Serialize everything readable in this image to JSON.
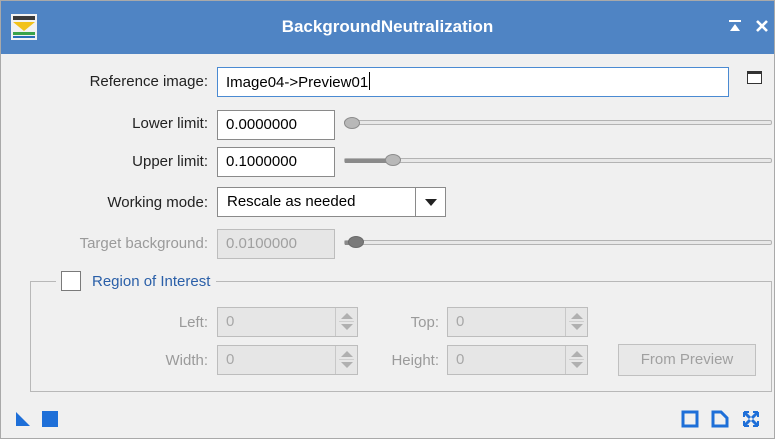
{
  "window": {
    "title": "BackgroundNeutralization",
    "colors": {
      "titlebar": "#4f84c4",
      "accent_icon": "#1e6fd8",
      "group_title": "#2a5fa8"
    }
  },
  "form": {
    "reference_image": {
      "label": "Reference image:",
      "value": "Image04->Preview01"
    },
    "lower_limit": {
      "label": "Lower limit:",
      "value": "0.0000000",
      "slider_fraction": 0.0
    },
    "upper_limit": {
      "label": "Upper limit:",
      "value": "0.1000000",
      "slider_fraction": 0.1
    },
    "working_mode": {
      "label": "Working mode:",
      "value": "Rescale as needed"
    },
    "target_background": {
      "label": "Target background:",
      "value": "0.0100000",
      "slider_fraction": 0.01,
      "enabled": false
    }
  },
  "roi": {
    "title": "Region of Interest",
    "checked": false,
    "left": {
      "label": "Left:",
      "value": "0"
    },
    "top": {
      "label": "Top:",
      "value": "0"
    },
    "width": {
      "label": "Width:",
      "value": "0"
    },
    "height": {
      "label": "Height:",
      "value": "0"
    },
    "from_preview_label": "From Preview"
  },
  "icons": {
    "app": "pixinsight-process-icon",
    "title_buttons": [
      "shade-icon",
      "close-icon"
    ],
    "bottom_left": [
      "new-instance-icon",
      "apply-icon"
    ],
    "bottom_right": [
      "reset-icon",
      "browse-documentation-icon",
      "preferences-icon"
    ]
  }
}
